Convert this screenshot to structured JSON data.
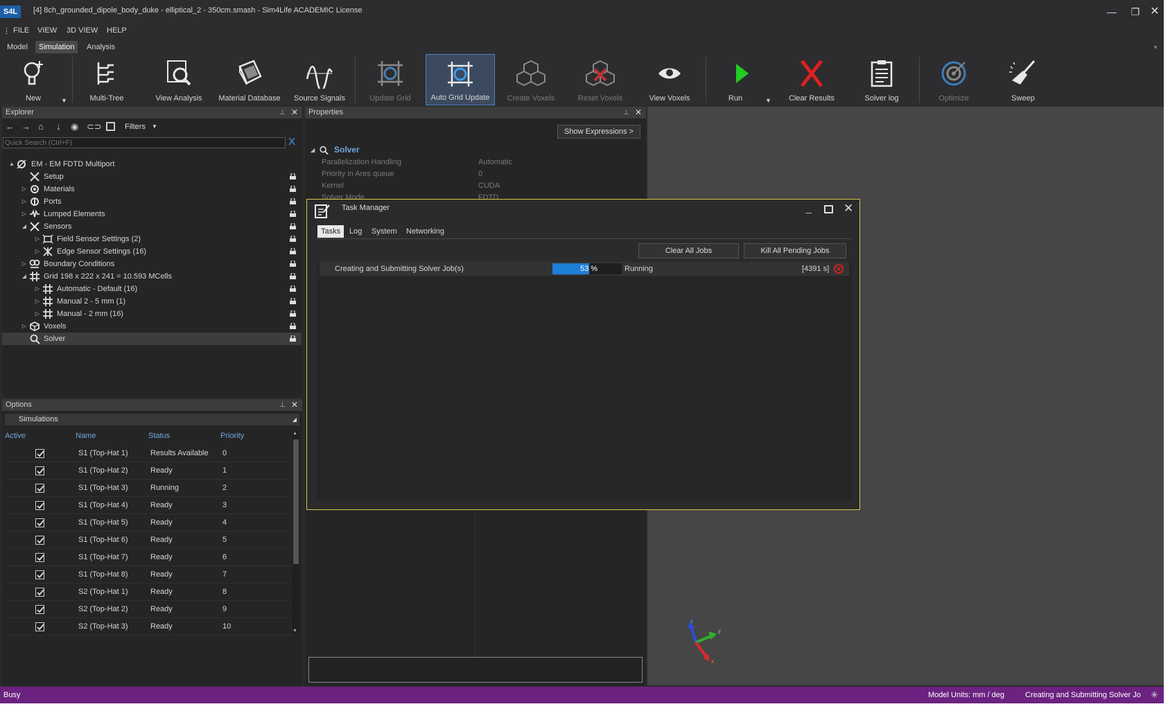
{
  "window": {
    "logo": "S4L",
    "title": "[4] 8ch_grounded_dipole_body_duke - elliptical_2 - 350cm.smash - Sim4Life ACADEMIC License"
  },
  "menu": {
    "grip": "⋮",
    "file": "FILE",
    "view": "VIEW",
    "view3d": "3D VIEW",
    "help": "HELP"
  },
  "ribbon_tabs": {
    "model": "Model",
    "simulation": "Simulation",
    "analysis": "Analysis",
    "active": "Simulation"
  },
  "ribbon": {
    "new": "New",
    "multitree": "Multi-Tree",
    "view_analysis": "View Analysis",
    "material_db": "Material Database",
    "source_signals": "Source Signals",
    "update_grid": "Update Grid",
    "auto_grid_update": "Auto Grid Update",
    "create_voxels": "Create Voxels",
    "reset_voxels": "Reset Voxels",
    "view_voxels": "View Voxels",
    "run": "Run",
    "clear_results": "Clear Results",
    "solver_log": "Solver log",
    "optimize": "Optimize",
    "sweep": "Sweep"
  },
  "explorer": {
    "title": "Explorer",
    "filters": "Filters",
    "search_placeholder": "Quick Search (Ctrl+F)",
    "search_clear": "X",
    "tree": [
      {
        "label": "EM - EM FDTD Multiport",
        "icon": "em-icon",
        "expander": "▲",
        "locked": false
      },
      {
        "label": "Setup",
        "icon": "setup-icon",
        "expander": "",
        "locked": true
      },
      {
        "label": "Materials",
        "icon": "materials-icon",
        "expander": "▷",
        "locked": true
      },
      {
        "label": "Ports",
        "icon": "ports-icon",
        "expander": "▷",
        "locked": true
      },
      {
        "label": "Lumped Elements",
        "icon": "lumped-icon",
        "expander": "▷",
        "locked": true
      },
      {
        "label": "Sensors",
        "icon": "sensors-icon",
        "expander": "◢",
        "locked": true
      },
      {
        "label": "Field Sensor Settings (2)",
        "icon": "field-sensor-icon",
        "expander": "▷",
        "locked": true
      },
      {
        "label": "Edge Sensor Settings (16)",
        "icon": "edge-sensor-icon",
        "expander": "▷",
        "locked": true
      },
      {
        "label": "Boundary Conditions",
        "icon": "boundary-icon",
        "expander": "▷",
        "locked": true
      },
      {
        "label": "Grid 198 x 222 x 241 = 10.593 MCells",
        "icon": "grid-icon",
        "expander": "◢",
        "locked": true
      },
      {
        "label": "Automatic - Default (16)",
        "icon": "grid-icon",
        "expander": "▷",
        "locked": true
      },
      {
        "label": "Manual 2 - 5 mm (1)",
        "icon": "grid-icon",
        "expander": "▷",
        "locked": true
      },
      {
        "label": "Manual - 2 mm (16)",
        "icon": "grid-icon",
        "expander": "▷",
        "locked": true
      },
      {
        "label": "Voxels",
        "icon": "voxels-icon",
        "expander": "▷",
        "locked": true
      },
      {
        "label": "Solver",
        "icon": "solver-icon",
        "expander": "",
        "locked": true
      }
    ]
  },
  "properties": {
    "title": "Properties",
    "show_expr": "Show Expressions >",
    "section": "Solver",
    "rows": [
      {
        "name": "Parallelization Handling",
        "value": "Automatic"
      },
      {
        "name": "Priority in Ares queue",
        "value": "0"
      },
      {
        "name": "Kernel",
        "value": "CUDA"
      },
      {
        "name": "Solver Mode",
        "value": "FDTD"
      }
    ]
  },
  "options": {
    "title": "Options",
    "simulations": "Simulations",
    "headers": {
      "active": "Active",
      "name": "Name",
      "status": "Status",
      "priority": "Priority"
    },
    "rows": [
      {
        "name": "S1  (Top-Hat 1)",
        "status": "Results Available",
        "priority": "0"
      },
      {
        "name": "S1  (Top-Hat 2)",
        "status": "Ready",
        "priority": "1"
      },
      {
        "name": "S1  (Top-Hat 3)",
        "status": "Running",
        "priority": "2"
      },
      {
        "name": "S1  (Top-Hat 4)",
        "status": "Ready",
        "priority": "3"
      },
      {
        "name": "S1  (Top-Hat 5)",
        "status": "Ready",
        "priority": "4"
      },
      {
        "name": "S1  (Top-Hat 6)",
        "status": "Ready",
        "priority": "5"
      },
      {
        "name": "S1  (Top-Hat 7)",
        "status": "Ready",
        "priority": "6"
      },
      {
        "name": "S1  (Top-Hat 8)",
        "status": "Ready",
        "priority": "7"
      },
      {
        "name": "S2  (Top-Hat 1)",
        "status": "Ready",
        "priority": "8"
      },
      {
        "name": "S2  (Top-Hat 2)",
        "status": "Ready",
        "priority": "9"
      },
      {
        "name": "S2  (Top-Hat 3)",
        "status": "Ready",
        "priority": "10"
      }
    ]
  },
  "task_manager": {
    "title": "Task Manager",
    "tabs": {
      "tasks": "Tasks",
      "log": "Log",
      "system": "System",
      "networking": "Networking"
    },
    "clear_all": "Clear All Jobs",
    "kill_pending": "Kill All Pending Jobs",
    "job": {
      "name": "Creating and Submitting Solver Job(s)",
      "progress": 0.53,
      "progress_text": "53 %",
      "state": "Running",
      "elapsed": "[4391 s]"
    }
  },
  "axes": {
    "y": "y",
    "x": "x",
    "z": "z"
  },
  "status": {
    "left": "Busy",
    "units": "Model Units: mm / deg",
    "message": "Creating and Submitting Solver Jo"
  },
  "colors": {
    "status_bg": "#6c2281",
    "accent": "#1e7fd6",
    "tm_border": "#d4c94a",
    "run": "#22cc22",
    "clear": "#e02020"
  }
}
